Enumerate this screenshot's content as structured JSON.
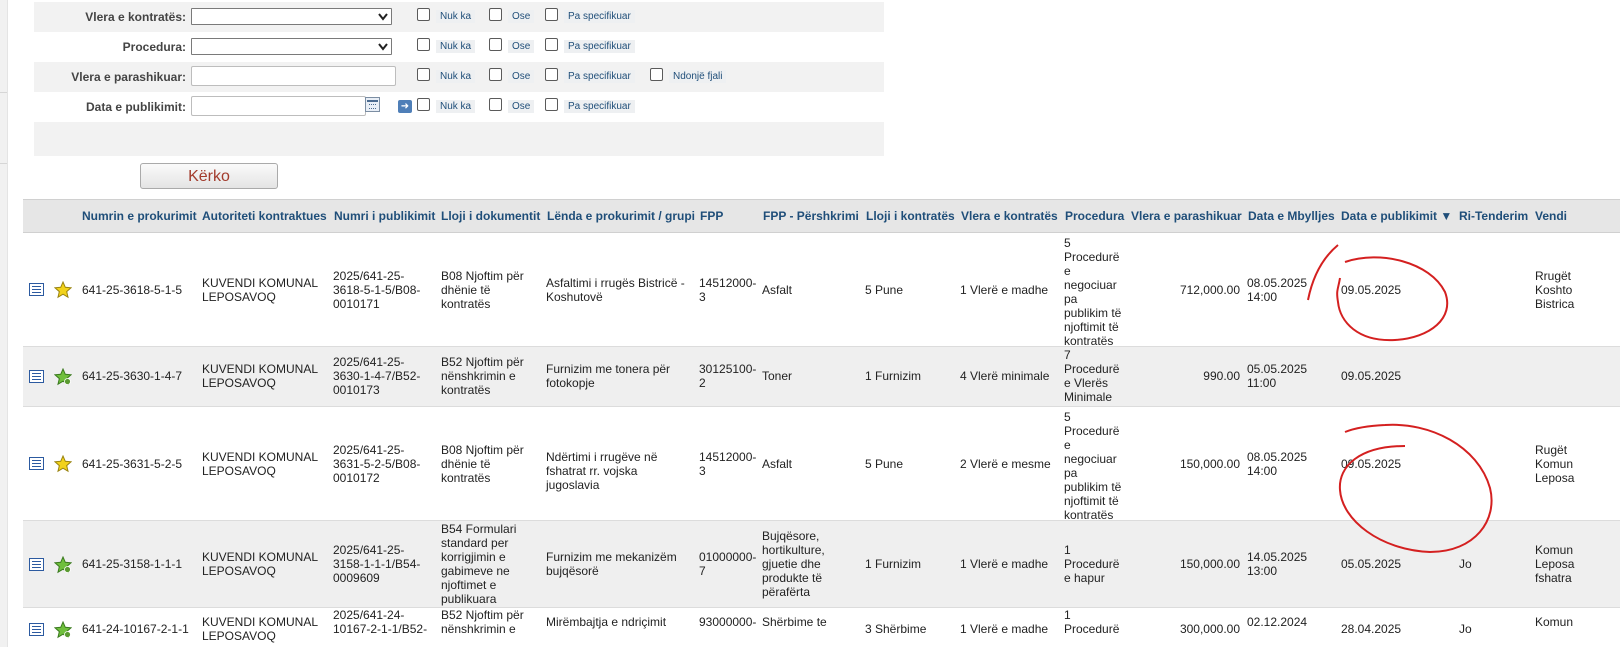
{
  "search_form": {
    "rows": [
      {
        "label": "Vlera e kontratës:",
        "control": "select",
        "options": [
          "Nuk ka",
          "Ose",
          "Pa specifikuar"
        ]
      },
      {
        "label": "Procedura:",
        "control": "select",
        "options": [
          "Nuk ka",
          "Ose",
          "Pa specifikuar"
        ]
      },
      {
        "label": "Vlera e parashikuar:",
        "control": "text",
        "options": [
          "Nuk ka",
          "Ose",
          "Pa specifikuar",
          "Ndonjë fjali"
        ]
      },
      {
        "label": "Data e publikimit:",
        "control": "date",
        "options": [
          "Nuk ka",
          "Ose",
          "Pa specifikuar"
        ]
      }
    ],
    "search_button": "Kërko"
  },
  "table": {
    "columns": [
      "Numrin e prokurimit",
      "Autoriteti kontraktues",
      "Numri i publikimit",
      "Lloji i dokumentit",
      "Lënda e prokurimit / grupi",
      "FPP",
      "FPP - Përshkrimi",
      "Lloji i kontratës",
      "Vlera e kontratës",
      "Procedura",
      "Vlera e parashikuar",
      "Data e Mbylljes",
      "Data e publikimit ▼",
      "Ri-Tenderim",
      "Vendi"
    ],
    "rows": [
      {
        "star": "yellow",
        "num": "641-25-3618-5-1-5",
        "auth": "KUVENDI KOMUNAL LEPOSAVOQ",
        "pub": "2025/641-25-3618-5-1-5/B08-0010171",
        "doc": "B08 Njoftim për dhënie të kontratës",
        "subj": "Asfaltimi i rrugës Bistricë - Koshutovë",
        "fpp": "14512000-3",
        "fppd": "Asfalt",
        "ctype": "5 Pune",
        "cval": "1 Vlerë e madhe",
        "proc": "5 Procedurë e negociuar pa publikim të njoftimit të kontratës",
        "est": "712,000.00",
        "close": "08.05.2025 14:00",
        "pubdate": "09.05.2025",
        "retender": "",
        "place": "Rrugët Koshto Bistrica"
      },
      {
        "star": "green",
        "num": "641-25-3630-1-4-7",
        "auth": "KUVENDI KOMUNAL LEPOSAVOQ",
        "pub": "2025/641-25-3630-1-4-7/B52-0010173",
        "doc": "B52 Njoftim për nënshkrimin e kontratës",
        "subj": "Furnizim me tonera për fotokopje",
        "fpp": "30125100-2",
        "fppd": "Toner",
        "ctype": "1 Furnizim",
        "cval": "4 Vlerë minimale",
        "proc": "7 Procedurë e Vlerës Minimale",
        "est": "990.00",
        "close": "05.05.2025 11:00",
        "pubdate": "09.05.2025",
        "retender": "",
        "place": ""
      },
      {
        "star": "yellow",
        "num": "641-25-3631-5-2-5",
        "auth": "KUVENDI KOMUNAL LEPOSAVOQ",
        "pub": "2025/641-25-3631-5-2-5/B08-0010172",
        "doc": "B08 Njoftim për dhënie të kontratës",
        "subj": "Ndërtimi i rrugëve në fshatrat rr. vojska jugoslavia",
        "fpp": "14512000-3",
        "fppd": "Asfalt",
        "ctype": "5 Pune",
        "cval": "2 Vlerë e mesme",
        "proc": "5 Procedurë e negociuar pa publikim të njoftimit të kontratës",
        "est": "150,000.00",
        "close": "08.05.2025 14:00",
        "pubdate": "09.05.2025",
        "retender": "",
        "place": "Rugët Komun Leposa"
      },
      {
        "star": "green",
        "num": "641-25-3158-1-1-1",
        "auth": "KUVENDI KOMUNAL LEPOSAVOQ",
        "pub": "2025/641-25-3158-1-1-1/B54-0009609",
        "doc": "B54 Formulari standard per korrigjimin e gabimeve ne njoftimet e publikuara",
        "subj": "Furnizim me mekanizëm bujqësorë",
        "fpp": "01000000-7",
        "fppd": "Bujqësore, hortikulture, gjuetie dhe produkte të përafërta",
        "ctype": "1 Furnizim",
        "cval": "1 Vlerë e madhe",
        "proc": "1 Procedurë e hapur",
        "est": "150,000.00",
        "close": "14.05.2025 13:00",
        "pubdate": "05.05.2025",
        "retender": "Jo",
        "place": "Komun Leposa fshatra"
      },
      {
        "star": "green",
        "num": "641-24-10167-2-1-1",
        "auth": "KUVENDI KOMUNAL LEPOSAVOQ",
        "pub": "2025/641-24-10167-2-1-1/B52-",
        "doc": "B52 Njoftim për nënshkrimin e",
        "subj": "Mirëmbajtja e ndriçimit",
        "fpp": "93000000-",
        "fppd": "Shërbime te",
        "ctype": "3 Shërbime",
        "cval": "1 Vlerë e madhe",
        "proc": "1 Procedurë",
        "est": "300,000.00",
        "close": "02.12.2024",
        "pubdate": "28.04.2025",
        "retender": "Jo",
        "place": "Komun"
      }
    ]
  },
  "colors": {
    "header_text": "#1f4e79",
    "button_text": "#a23b2c",
    "annotation": "#d42020"
  }
}
